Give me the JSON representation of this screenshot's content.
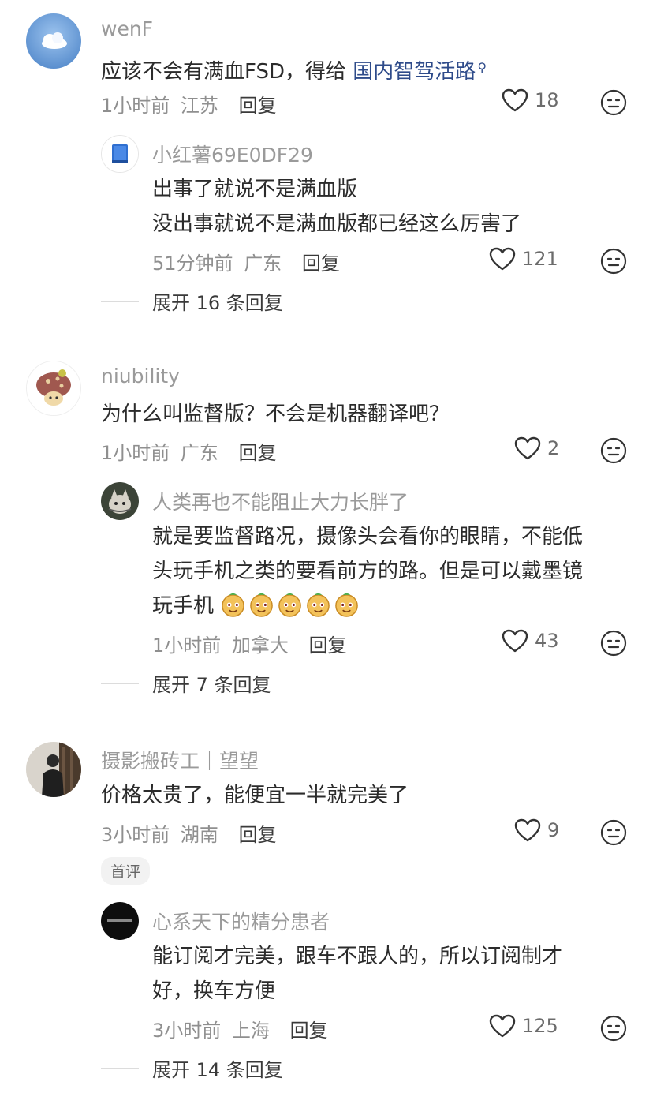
{
  "comments": [
    {
      "author": "wenF",
      "text_before_link": "应该不会有满血FSD，得给 ",
      "link_text": "国内智驾活路",
      "time": "1小时前",
      "location": "江苏",
      "reply_label": "回复",
      "likes": "18",
      "reply": {
        "author": "小红薯69E0DF29",
        "lines": [
          "出事了就说不是满血版",
          "没出事就说不是满血版都已经这么厉害了"
        ],
        "time": "51分钟前",
        "location": "广东",
        "reply_label": "回复",
        "likes": "121"
      },
      "expand": "展开 16 条回复"
    },
    {
      "author": "niubility",
      "text": "为什么叫监督版？不会是机器翻译吧？",
      "time": "1小时前",
      "location": "广东",
      "reply_label": "回复",
      "likes": "2",
      "reply": {
        "author": "人类再也不能阻止大力长胖了",
        "lines": [
          "就是要监督路况，摄像头会看你的眼睛，不能低",
          "头玩手机之类的要看前方的路。但是可以戴墨镜",
          "玩手机"
        ],
        "time": "1小时前",
        "location": "加拿大",
        "reply_label": "回复",
        "likes": "43"
      },
      "expand": "展开 7 条回复"
    },
    {
      "author": "摄影搬砖工｜望望",
      "text": "价格太贵了，能便宜一半就完美了",
      "time": "3小时前",
      "location": "湖南",
      "reply_label": "回复",
      "likes": "9",
      "tag": "首评",
      "reply": {
        "author": "心系天下的精分患者",
        "lines": [
          "能订阅才完美，跟车不跟人的，所以订阅制才",
          "好，换车方便"
        ],
        "time": "3小时前",
        "location": "上海",
        "reply_label": "回复",
        "likes": "125"
      },
      "expand": "展开 14 条回复"
    }
  ],
  "colors": {
    "link": "#2e4b8a",
    "meta": "#8f8f8f",
    "name": "#9a9a9a"
  }
}
